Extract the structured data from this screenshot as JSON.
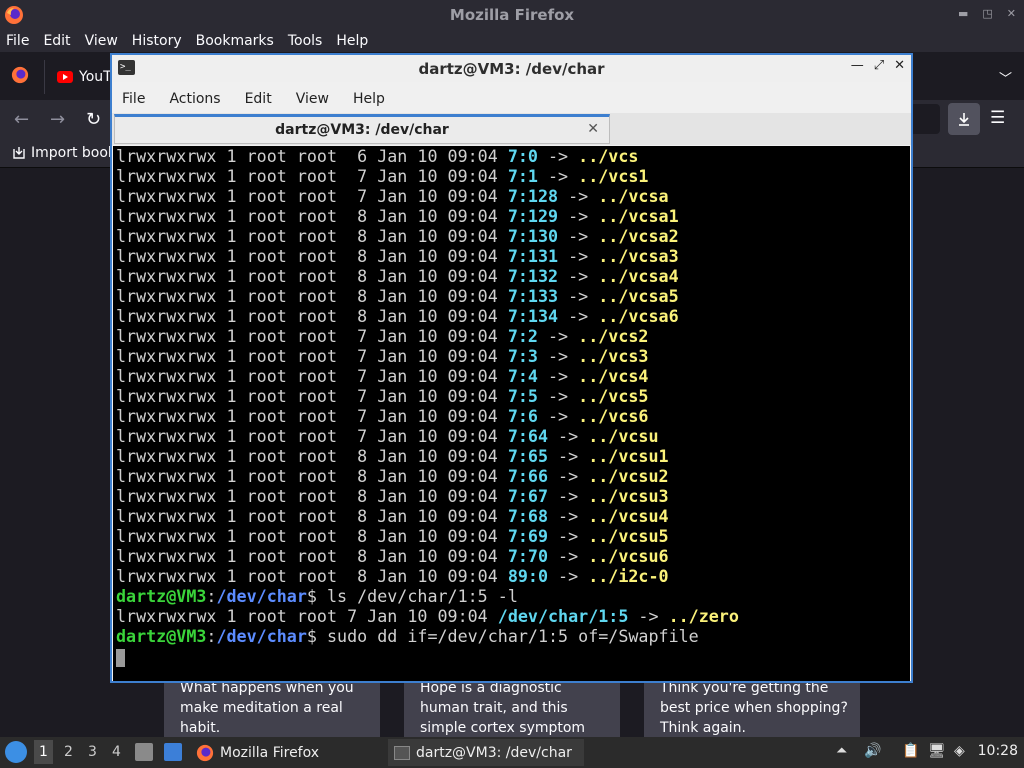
{
  "firefox": {
    "title": "Mozilla Firefox",
    "menu": [
      "File",
      "Edit",
      "View",
      "History",
      "Bookmarks",
      "Tools",
      "Help"
    ],
    "tab_youtube": "YouTu",
    "bookmark_import": "Import book"
  },
  "cards": [
    {
      "text": "What happens when you make meditation a real habit."
    },
    {
      "text": "Hope is a diagnostic human trait, and this simple cortex symptom seems to be a…"
    },
    {
      "text": "Think you're getting the best price when shopping? Think again."
    }
  ],
  "terminal": {
    "title": "dartz@VM3: /dev/char",
    "tab_title": "dartz@VM3: /dev/char",
    "menu": [
      "File",
      "Actions",
      "Edit",
      "View",
      "Help"
    ],
    "lines": [
      {
        "perm": "lrwxrwxrwx 1 root root  6 Jan 10 09:04 ",
        "dev": "7:0",
        "arrow": " -> ",
        "target": "../vcs"
      },
      {
        "perm": "lrwxrwxrwx 1 root root  7 Jan 10 09:04 ",
        "dev": "7:1",
        "arrow": " -> ",
        "target": "../vcs1"
      },
      {
        "perm": "lrwxrwxrwx 1 root root  7 Jan 10 09:04 ",
        "dev": "7:128",
        "arrow": " -> ",
        "target": "../vcsa"
      },
      {
        "perm": "lrwxrwxrwx 1 root root  8 Jan 10 09:04 ",
        "dev": "7:129",
        "arrow": " -> ",
        "target": "../vcsa1"
      },
      {
        "perm": "lrwxrwxrwx 1 root root  8 Jan 10 09:04 ",
        "dev": "7:130",
        "arrow": " -> ",
        "target": "../vcsa2"
      },
      {
        "perm": "lrwxrwxrwx 1 root root  8 Jan 10 09:04 ",
        "dev": "7:131",
        "arrow": " -> ",
        "target": "../vcsa3"
      },
      {
        "perm": "lrwxrwxrwx 1 root root  8 Jan 10 09:04 ",
        "dev": "7:132",
        "arrow": " -> ",
        "target": "../vcsa4"
      },
      {
        "perm": "lrwxrwxrwx 1 root root  8 Jan 10 09:04 ",
        "dev": "7:133",
        "arrow": " -> ",
        "target": "../vcsa5"
      },
      {
        "perm": "lrwxrwxrwx 1 root root  8 Jan 10 09:04 ",
        "dev": "7:134",
        "arrow": " -> ",
        "target": "../vcsa6"
      },
      {
        "perm": "lrwxrwxrwx 1 root root  7 Jan 10 09:04 ",
        "dev": "7:2",
        "arrow": " -> ",
        "target": "../vcs2"
      },
      {
        "perm": "lrwxrwxrwx 1 root root  7 Jan 10 09:04 ",
        "dev": "7:3",
        "arrow": " -> ",
        "target": "../vcs3"
      },
      {
        "perm": "lrwxrwxrwx 1 root root  7 Jan 10 09:04 ",
        "dev": "7:4",
        "arrow": " -> ",
        "target": "../vcs4"
      },
      {
        "perm": "lrwxrwxrwx 1 root root  7 Jan 10 09:04 ",
        "dev": "7:5",
        "arrow": " -> ",
        "target": "../vcs5"
      },
      {
        "perm": "lrwxrwxrwx 1 root root  7 Jan 10 09:04 ",
        "dev": "7:6",
        "arrow": " -> ",
        "target": "../vcs6"
      },
      {
        "perm": "lrwxrwxrwx 1 root root  7 Jan 10 09:04 ",
        "dev": "7:64",
        "arrow": " -> ",
        "target": "../vcsu"
      },
      {
        "perm": "lrwxrwxrwx 1 root root  8 Jan 10 09:04 ",
        "dev": "7:65",
        "arrow": " -> ",
        "target": "../vcsu1"
      },
      {
        "perm": "lrwxrwxrwx 1 root root  8 Jan 10 09:04 ",
        "dev": "7:66",
        "arrow": " -> ",
        "target": "../vcsu2"
      },
      {
        "perm": "lrwxrwxrwx 1 root root  8 Jan 10 09:04 ",
        "dev": "7:67",
        "arrow": " -> ",
        "target": "../vcsu3"
      },
      {
        "perm": "lrwxrwxrwx 1 root root  8 Jan 10 09:04 ",
        "dev": "7:68",
        "arrow": " -> ",
        "target": "../vcsu4"
      },
      {
        "perm": "lrwxrwxrwx 1 root root  8 Jan 10 09:04 ",
        "dev": "7:69",
        "arrow": " -> ",
        "target": "../vcsu5"
      },
      {
        "perm": "lrwxrwxrwx 1 root root  8 Jan 10 09:04 ",
        "dev": "7:70",
        "arrow": " -> ",
        "target": "../vcsu6"
      },
      {
        "perm": "lrwxrwxrwx 1 root root  8 Jan 10 09:04 ",
        "dev": "89:0",
        "arrow": " -> ",
        "target": "../i2c-0"
      }
    ],
    "prompt_user": "dartz@VM3",
    "prompt_sep": ":",
    "prompt_path": "/dev/char",
    "prompt_end": "$ ",
    "cmd1": "ls /dev/char/1:5 -l",
    "result_perm": "lrwxrwxrwx 1 root root 7 Jan 10 09:04 ",
    "result_dev": "/dev/char/1:5",
    "result_arrow": " -> ",
    "result_target": "../zero",
    "cmd2": "sudo dd if=/dev/char/1:5 of=/Swapfile"
  },
  "taskbar": {
    "workspaces": [
      "1",
      "2",
      "3",
      "4"
    ],
    "task_firefox": "Mozilla Firefox",
    "task_terminal": "dartz@VM3: /dev/char",
    "clock": "10:28"
  }
}
